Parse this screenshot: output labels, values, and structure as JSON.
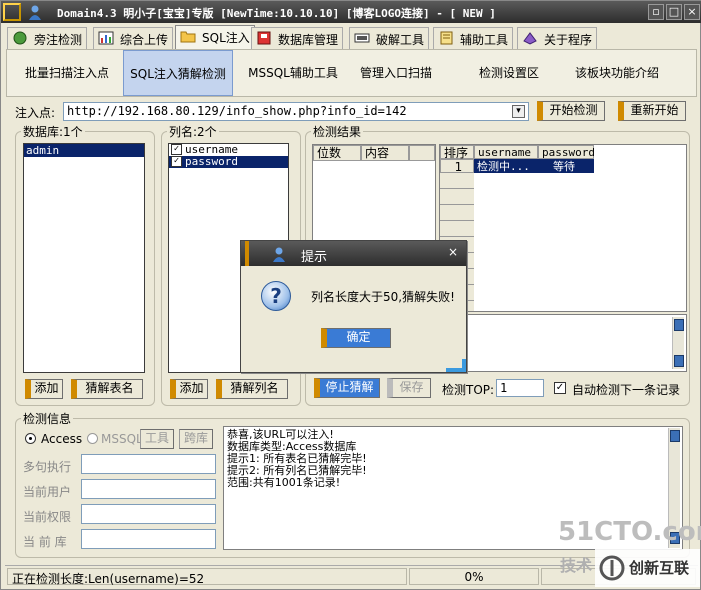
{
  "window": {
    "title": "Domain4.3 明小子[宝宝]专版 [NewTime:10.10.10] [博客LOGO连接]  - [ NEW ]",
    "controls": [
      "▫",
      "□",
      "×"
    ]
  },
  "tabs": [
    {
      "label": "旁注检测",
      "icon": "globe-icon"
    },
    {
      "label": "综合上传",
      "icon": "chart-icon"
    },
    {
      "label": "SQL注入",
      "icon": "folder-icon"
    },
    {
      "label": "数据库管理",
      "icon": "database-icon"
    },
    {
      "label": "破解工具",
      "icon": "tools-icon"
    },
    {
      "label": "辅助工具",
      "icon": "notebook-icon"
    },
    {
      "label": "关于程序",
      "icon": "info-icon"
    }
  ],
  "subnav": [
    "批量扫描注入点",
    "SQL注入猜解检测",
    "MSSQL辅助工具",
    "管理入口扫描",
    "检测设置区",
    "该板块功能介绍"
  ],
  "injection": {
    "label": "注入点:",
    "url": "http://192.168.80.129/info_show.php?info_id=142",
    "start_button": "开始检测",
    "restart_button": "重新开始"
  },
  "database_panel": {
    "label": "数据库:1个",
    "items": [
      "admin"
    ],
    "add_button": "添加",
    "guess_button": "猜解表名"
  },
  "column_panel": {
    "label": "列名:2个",
    "items": [
      "username",
      "password"
    ],
    "add_button": "添加",
    "guess_button": "猜解列名"
  },
  "results": {
    "label": "检测结果",
    "left_headers": [
      "位数",
      "内容"
    ],
    "right_headers": [
      "排序",
      "username",
      "password"
    ],
    "row": {
      "index": "1",
      "username": "检测中...",
      "password": "等待"
    },
    "stop_button": "停止猜解",
    "save_button": "保存",
    "top_label": "检测TOP:",
    "top_value": "1",
    "auto_check": "自动检测下一条记录"
  },
  "info": {
    "label": "检测信息",
    "access": "Access",
    "mssql": "MSSQL",
    "tool_btn": "工具",
    "cross_btn": "跨库",
    "fields": [
      "多句执行",
      "当前用户",
      "当前权限",
      "当 前 库"
    ],
    "log": [
      "恭喜,该URL可以注入!",
      "数据库类型:Access数据库",
      "提示1: 所有表名已猜解完毕!",
      "提示2: 所有列名已猜解完毕!",
      "范围:共有1001条记录!"
    ]
  },
  "dialog": {
    "title": "提示",
    "message": "列名长度大于50,猜解失败!",
    "ok": "确定"
  },
  "status": {
    "text": "正在检测长度:Len(username)=52",
    "progress": "0%"
  },
  "watermarks": {
    "site": "51CTO.com",
    "tech": "技术",
    "brand": "创新互联"
  }
}
